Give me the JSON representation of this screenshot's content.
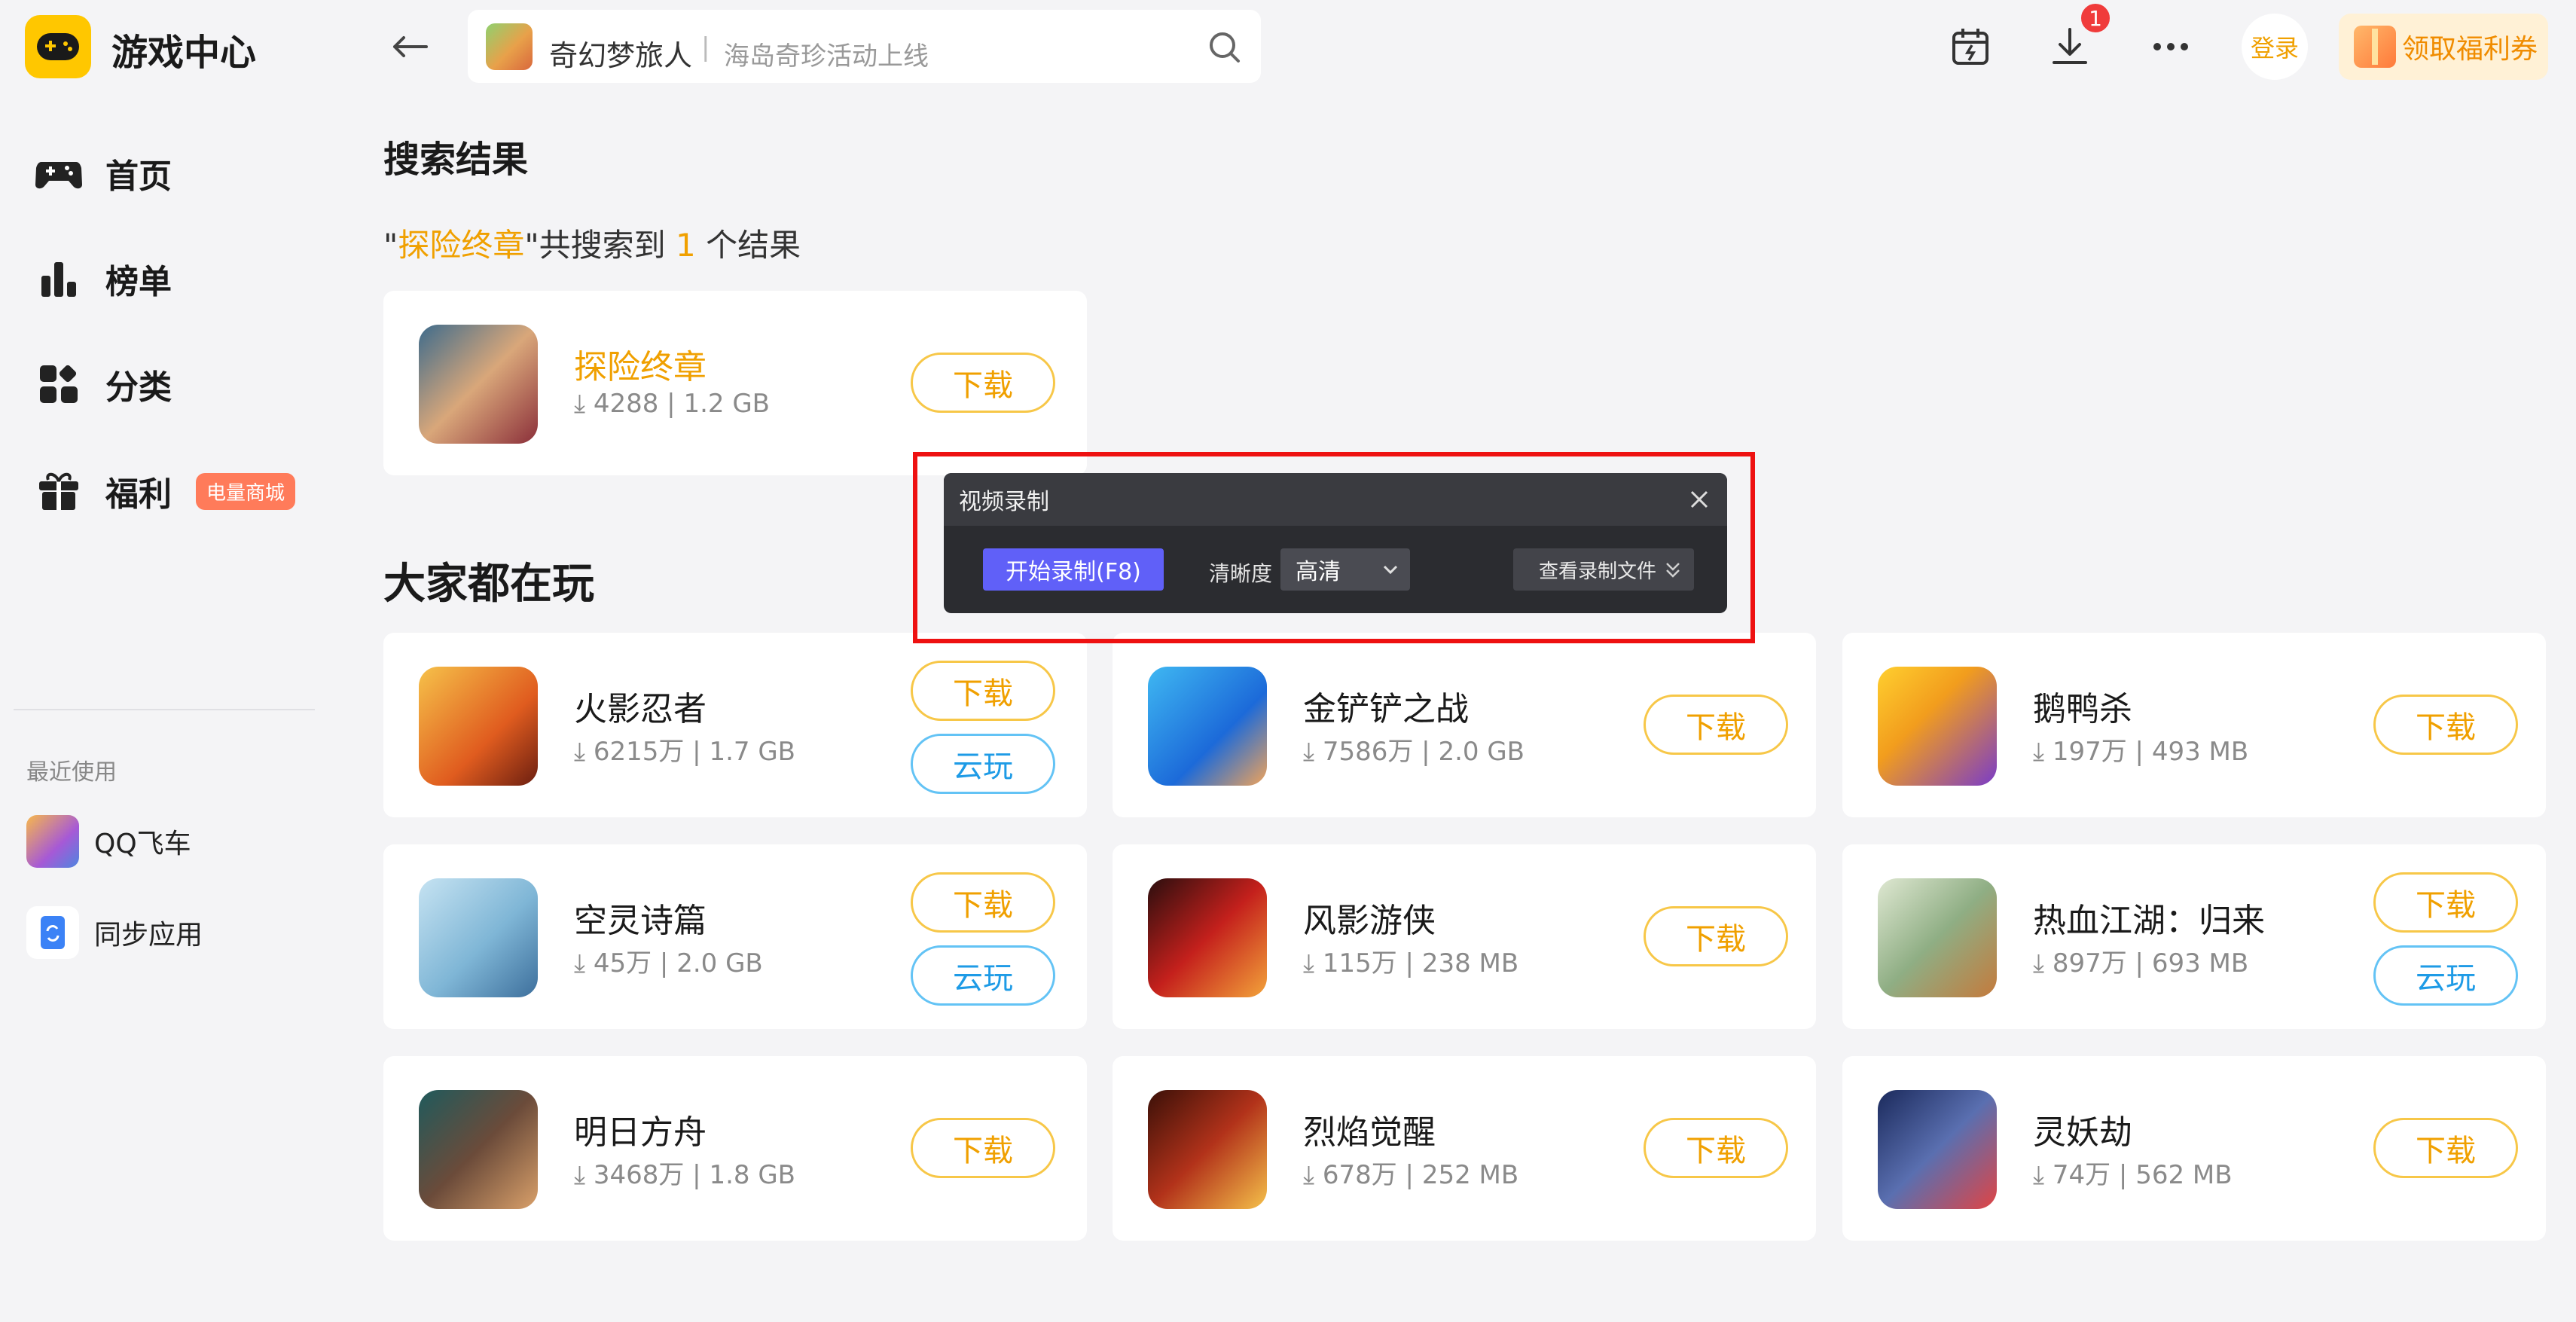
{
  "app": {
    "title": "游戏中心"
  },
  "search": {
    "game_title": "奇幻梦旅人",
    "separator": "|",
    "subtitle": "海岛奇珍活动上线"
  },
  "header": {
    "download_badge": "1",
    "login_label": "登录",
    "coupon_label": "领取福利券"
  },
  "sidebar": {
    "items": [
      {
        "label": "首页"
      },
      {
        "label": "榜单"
      },
      {
        "label": "分类"
      },
      {
        "label": "福利",
        "tag": "电量商城"
      }
    ],
    "recent_title": "最近使用",
    "recent": [
      {
        "label": "QQ飞车"
      },
      {
        "label": "同步应用"
      }
    ]
  },
  "results": {
    "heading": "搜索结果",
    "query_open_quote": "\"",
    "query": "探险终章",
    "query_close_quote": "\"共搜索到 ",
    "count": "1",
    "suffix": " 个结果",
    "card": {
      "name": "探险终章",
      "downloads": "4288",
      "size": "1.2 GB",
      "button": "下载"
    }
  },
  "popular": {
    "heading": "大家都在玩",
    "games": [
      {
        "name": "火影忍者",
        "downloads": "6215万",
        "size": "1.7 GB",
        "download": "下载",
        "cloud": "云玩"
      },
      {
        "name": "金铲铲之战",
        "downloads": "7586万",
        "size": "2.0 GB",
        "download": "下载"
      },
      {
        "name": "鹅鸭杀",
        "downloads": "197万",
        "size": "493 MB",
        "download": "下载"
      },
      {
        "name": "空灵诗篇",
        "downloads": "45万",
        "size": "2.0 GB",
        "download": "下载",
        "cloud": "云玩"
      },
      {
        "name": "风影游侠",
        "downloads": "115万",
        "size": "238 MB",
        "download": "下载"
      },
      {
        "name": "热血江湖：归来",
        "downloads": "897万",
        "size": "693 MB",
        "download": "下载",
        "cloud": "云玩"
      },
      {
        "name": "明日方舟",
        "downloads": "3468万",
        "size": "1.8 GB",
        "download": "下载"
      },
      {
        "name": "烈焰觉醒",
        "downloads": "678万",
        "size": "252 MB",
        "download": "下载"
      },
      {
        "name": "灵妖劫",
        "downloads": "74万",
        "size": "562 MB",
        "download": "下载"
      }
    ]
  },
  "recorder": {
    "title": "视频录制",
    "start_label": "开始录制(F8)",
    "quality_label": "清晰度",
    "quality_value": "高清",
    "view_files_label": "查看录制文件"
  },
  "colors": {
    "accent": "#f0a000",
    "brand_yellow": "#ffc700",
    "cloud_blue": "#1e9be6",
    "record_button": "#6060f8",
    "highlight_red": "#ee1111"
  },
  "icons": {
    "logo": "gamepad-icon",
    "back": "arrow-left-icon",
    "search": "search-icon",
    "calendar": "calendar-icon",
    "download": "download-icon",
    "more": "more-icon"
  }
}
